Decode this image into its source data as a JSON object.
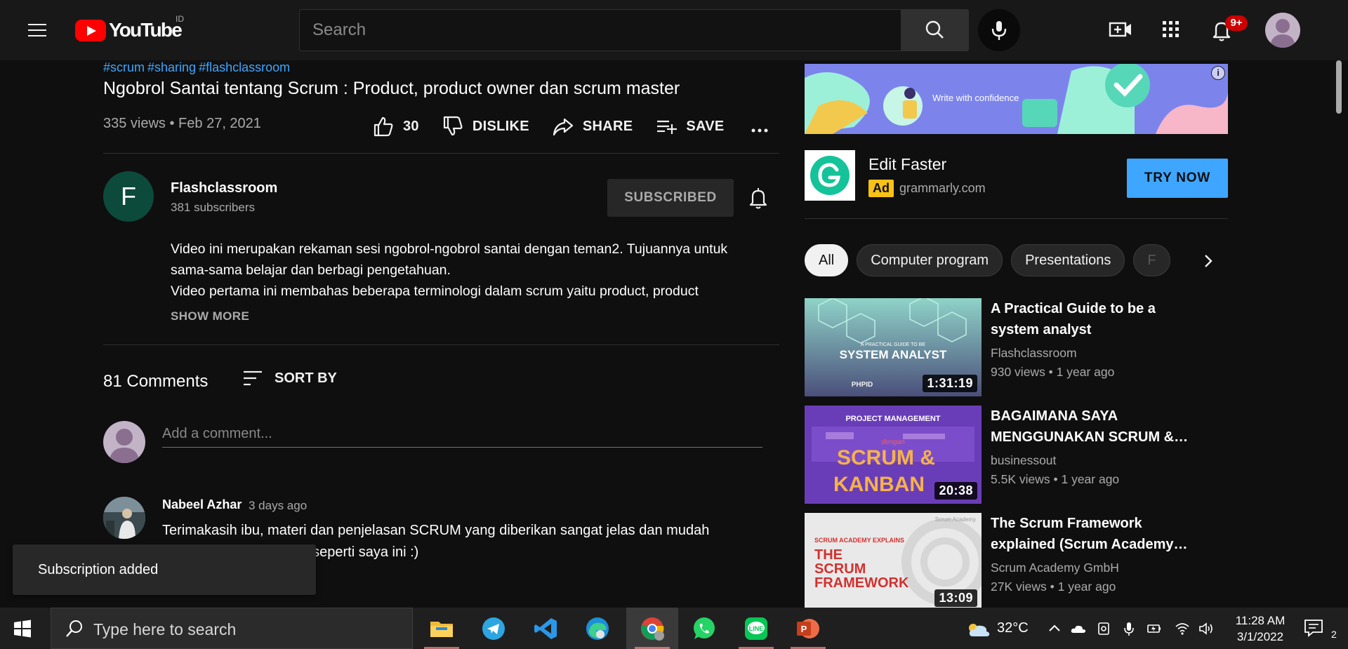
{
  "masthead": {
    "logo_text": "YouTube",
    "country_code": "ID",
    "search_placeholder": "Search",
    "notification_badge": "9+"
  },
  "video": {
    "hashtags": [
      "#scrum",
      "#sharing",
      "#flashclassroom"
    ],
    "title": "Ngobrol Santai tentang Scrum : Product, product owner dan scrum master",
    "meta": "335 views • Feb 27, 2021",
    "actions": {
      "like_count": "30",
      "dislike_label": "DISLIKE",
      "share_label": "SHARE",
      "save_label": "SAVE"
    }
  },
  "channel": {
    "avatar_letter": "F",
    "name": "Flashclassroom",
    "subscribers": "381 subscribers",
    "subscribe_state": "SUBSCRIBED"
  },
  "description": {
    "line1": "Video ini merupakan rekaman sesi ngobrol-ngobrol santai dengan teman2. Tujuannya untuk",
    "line2": "sama-sama belajar dan berbagi pengetahuan.",
    "line3": "Video pertama ini membahas beberapa terminologi dalam scrum yaitu product, product",
    "show_more": "SHOW MORE"
  },
  "comments": {
    "count_label": "81 Comments",
    "sort_label": "SORT BY",
    "add_placeholder": "Add a comment...",
    "items": [
      {
        "author": "Nabeel Azhar",
        "time": "3 days ago",
        "line1": "Terimakasih ibu, materi dan penjelasan SCRUM yang diberikan sangat jelas dan mudah",
        "line2": "wa seperti saya ini :)"
      }
    ]
  },
  "toast": {
    "message": "Subscription added"
  },
  "ad": {
    "banner_caption": "Write with confidence",
    "title": "Edit Faster",
    "badge": "Ad",
    "domain": "grammarly.com",
    "cta": "TRY NOW",
    "info": "i"
  },
  "chips": [
    "All",
    "Computer program",
    "Presentations",
    "F"
  ],
  "recommendations": [
    {
      "title": "A Practical Guide to be a system analyst",
      "channel": "Flashclassroom",
      "meta": "930 views • 1 year ago",
      "duration": "1:31:19",
      "thumb_text": "SYSTEM ANALYST",
      "thumb_small": "A PRACTICAL GUIDE TO BE",
      "thumb_logo": "PHPID"
    },
    {
      "title": "BAGAIMANA SAYA MENGGUNAKAN SCRUM &…",
      "channel": "businessout",
      "meta": "5.5K views • 1 year ago",
      "duration": "20:38",
      "thumb_top": "PROJECT MANAGEMENT",
      "thumb_mid": "dengan",
      "thumb_line1": "SCRUM &",
      "thumb_line2": "KANBAN"
    },
    {
      "title": "The Scrum Framework explained (Scrum Academy…",
      "channel": "Scrum Academy GmbH",
      "meta": "27K views • 1 year ago",
      "duration": "13:09",
      "thumb_top": "SCRUM ACADEMY EXPLAINS",
      "thumb_line1": "THE",
      "thumb_line2": "SCRUM",
      "thumb_line3": "FRAMEWORK",
      "thumb_corner": "Scrum Academy"
    }
  ],
  "taskbar": {
    "search_placeholder": "Type here to search",
    "temperature": "32°C",
    "time": "11:28 AM",
    "date": "3/1/2022",
    "notification_count": "2"
  },
  "colors": {
    "accent_blue": "#3ea6ff",
    "brand_red": "#ff0000",
    "background": "#0f0f0f",
    "ad_yellow": "#f9c116"
  },
  "icons": [
    "menu-icon",
    "search-icon",
    "mic-icon",
    "create-video-icon",
    "apps-icon",
    "bell-icon",
    "like-icon",
    "dislike-icon",
    "share-icon",
    "save-icon",
    "more-icon",
    "sort-icon",
    "chevron-right-icon",
    "windows-icon"
  ]
}
